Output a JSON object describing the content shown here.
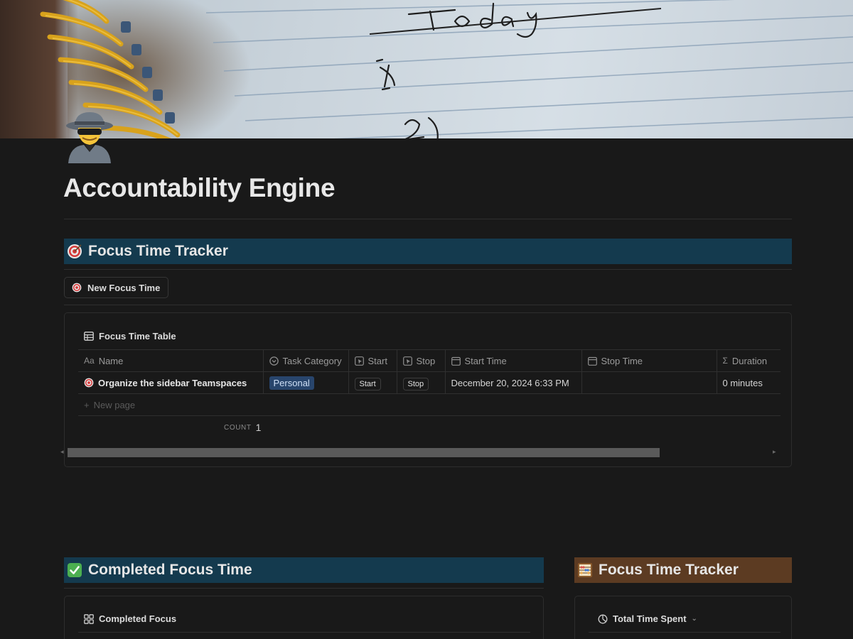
{
  "page": {
    "title": "Accountability Engine",
    "icon": "spy-detective-icon"
  },
  "focus_section": {
    "heading": "Focus Time Tracker",
    "heading_icon": "target-icon",
    "heading_color": "#143a4e",
    "new_button_label": "New Focus Time",
    "view_label": "Focus Time Table",
    "columns": [
      {
        "label": "Name",
        "icon": "Aa"
      },
      {
        "label": "Task Category",
        "icon": "select-icon"
      },
      {
        "label": "Start",
        "icon": "button-icon"
      },
      {
        "label": "Stop",
        "icon": "button-icon"
      },
      {
        "label": "Start Time",
        "icon": "calendar-icon"
      },
      {
        "label": "Stop Time",
        "icon": "calendar-icon"
      },
      {
        "label": "Duration",
        "icon": "Σ"
      }
    ],
    "rows": [
      {
        "name": "Organize the sidebar Teamspaces",
        "category": "Personal",
        "start_button": "Start",
        "stop_button": "Stop",
        "start_time": "December 20, 2024 6:33 PM",
        "stop_time": "",
        "duration": "0 minutes"
      }
    ],
    "new_page_label": "New page",
    "count_label": "COUNT",
    "count_value": "1"
  },
  "completed_section": {
    "heading": "Completed Focus Time",
    "heading_icon": "check-mark-icon",
    "view_label": "Completed Focus"
  },
  "tracker_section": {
    "heading": "Focus Time Tracker",
    "heading_icon": "abacus-icon",
    "heading_color": "#5c3b22",
    "view_label": "Total Time Spent"
  }
}
